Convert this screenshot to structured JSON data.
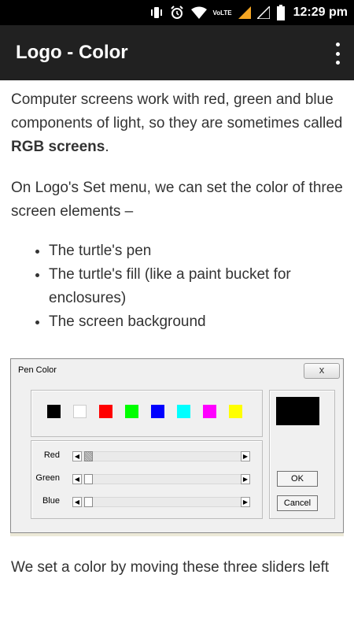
{
  "status_bar": {
    "time": "12:29 pm",
    "network_label": "VoLTE",
    "icons": [
      "vibrate-icon",
      "alarm-icon",
      "wifi-icon",
      "signal-icon",
      "signal-empty-icon",
      "battery-icon"
    ]
  },
  "app_bar": {
    "title": "Logo - Color",
    "menu_icon": "overflow-menu-icon"
  },
  "content": {
    "paragraph1_text": "Computer screens work with red, green and blue components of light, so they are sometimes called ",
    "paragraph1_bold": "RGB screens",
    "paragraph1_end": ".",
    "paragraph2": "On Logo's Set menu, we can set the color of three screen elements –",
    "bullets": [
      "The turtle's pen",
      "The turtle's fill (like a paint bucket for enclosures)",
      "The screen background"
    ],
    "bottom_text": "We set a color by moving these three sliders left"
  },
  "dialog": {
    "title": "Pen Color",
    "close_label": "x",
    "swatches": [
      "#000000",
      "#ffffff",
      "#ff0000",
      "#00ff00",
      "#0000ff",
      "#00ffff",
      "#ff00ff",
      "#ffff00"
    ],
    "sliders": [
      {
        "label": "Red",
        "value": 0
      },
      {
        "label": "Green",
        "value": 0
      },
      {
        "label": "Blue",
        "value": 0
      }
    ],
    "preview_color": "#000000",
    "ok_label": "OK",
    "cancel_label": "Cancel"
  }
}
